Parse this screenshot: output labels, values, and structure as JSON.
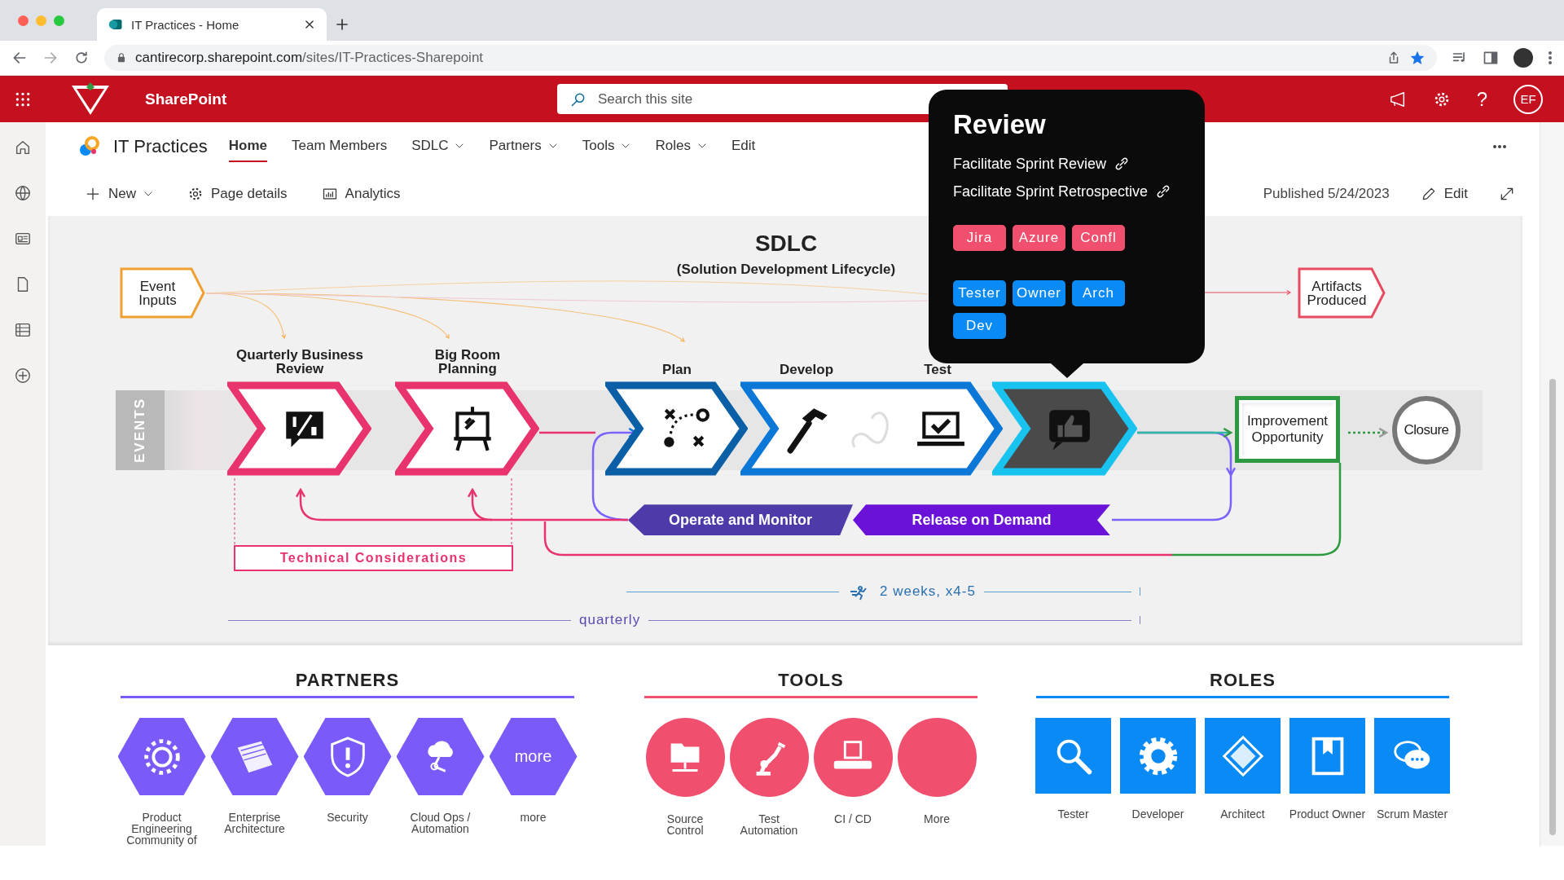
{
  "browser": {
    "tab": {
      "title": "IT Practices - Home",
      "selected": true
    },
    "url_host": "cantirecorp.sharepoint.com",
    "url_path": "/sites/IT-Practices-Sharepoint"
  },
  "suite_bar": {
    "app_name": "SharePoint",
    "search": {
      "placeholder": "Search this site"
    },
    "help": "?",
    "avatar": "EF"
  },
  "site": {
    "title": "IT Practices",
    "nav": [
      {
        "label": "Home",
        "selected": true,
        "has_menu": false
      },
      {
        "label": "Team Members",
        "selected": false,
        "has_menu": false
      },
      {
        "label": "SDLC",
        "selected": false,
        "has_menu": true
      },
      {
        "label": "Partners",
        "selected": false,
        "has_menu": true
      },
      {
        "label": "Tools",
        "selected": false,
        "has_menu": true
      },
      {
        "label": "Roles",
        "selected": false,
        "has_menu": true
      },
      {
        "label": "Edit",
        "selected": false,
        "has_menu": false
      }
    ]
  },
  "command_bar": {
    "actions": [
      {
        "label": "New",
        "kind": "new"
      },
      {
        "label": "Page details",
        "kind": "details"
      },
      {
        "label": "Analytics",
        "kind": "analytics"
      }
    ],
    "published": "Published 5/24/2023",
    "edit": "Edit"
  },
  "sdlc": {
    "title": "SDLC",
    "subtitle": "(Solution Development Lifecycle)",
    "inputs": "Event Inputs",
    "artifacts": "Artifacts Produced",
    "band_label": "EVENTS",
    "stages": [
      {
        "labels": [
          "Quarterly Business Review"
        ],
        "kind": "quarter",
        "color": "#e8336d",
        "selected": false
      },
      {
        "labels": [
          "Big Room Planning"
        ],
        "kind": "easel",
        "color": "#e8336d",
        "selected": false
      },
      {
        "labels": [
          "Plan"
        ],
        "kind": "plan",
        "color": "#0a5fa6",
        "selected": false
      },
      {
        "labels": [
          "Develop",
          "Test"
        ],
        "kind": "build",
        "color": "#0b78d8",
        "selected": false
      },
      {
        "kind": "review",
        "color": "#19c3ef",
        "selected": true
      }
    ],
    "improvement": "Improvement Opportunity",
    "closure": "Closure",
    "banners": [
      {
        "label": "Operate and Monitor",
        "color": "#4e3aa8"
      },
      {
        "label": "Release on Demand",
        "color": "#6a12d8"
      }
    ],
    "technical": "Technical Considerations",
    "spans": [
      {
        "label": "2 weeks, x4-5",
        "kind": "sprint"
      },
      {
        "label": "quarterly",
        "kind": "quarter"
      }
    ]
  },
  "tooltip": {
    "title": "Review",
    "links": [
      "Facilitate Sprint Review",
      "Facilitate Sprint Retrospective"
    ],
    "tools": [
      "Jira",
      "Azure",
      "Confl"
    ],
    "roles": [
      "Tester",
      "Owner",
      "Arch",
      "Dev"
    ]
  },
  "sections": [
    {
      "title": "PARTNERS",
      "color": "#7a5af8",
      "kind": "hexagon",
      "items": [
        {
          "label": "Product Engineering Community of",
          "kind": "network"
        },
        {
          "label": "Enterprise Architecture",
          "kind": "folder"
        },
        {
          "label": "Security",
          "kind": "shield"
        },
        {
          "label": "Cloud Ops / Automation",
          "kind": "cloud"
        },
        {
          "label": "more",
          "kind": "text",
          "inner": "more"
        }
      ]
    },
    {
      "title": "TOOLS",
      "color": "#f0506e",
      "kind": "circle",
      "items": [
        {
          "label": "Source Control",
          "kind": "server"
        },
        {
          "label": "Test Automation",
          "kind": "robot"
        },
        {
          "label": "CI / CD",
          "kind": "conveyor"
        },
        {
          "label": "More",
          "kind": "blank"
        }
      ]
    },
    {
      "title": "ROLES",
      "color": "#0a8af5",
      "kind": "square",
      "items": [
        {
          "label": "Tester",
          "kind": "search"
        },
        {
          "label": "Developer",
          "kind": "gear"
        },
        {
          "label": "Architect",
          "kind": "puzzle"
        },
        {
          "label": "Product Owner",
          "kind": "bookmark"
        },
        {
          "label": "Scrum Master",
          "kind": "chat"
        }
      ]
    }
  ]
}
